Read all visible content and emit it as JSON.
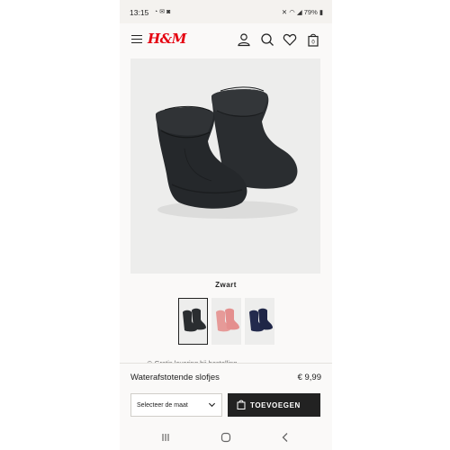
{
  "status_bar": {
    "time": "13:15",
    "notification_icons": [
      "whatsapp-icon",
      "mail-icon",
      "instagram-icon"
    ],
    "system_icons": [
      "mute-icon",
      "wifi-icon",
      "signal-icon",
      "battery-icon"
    ],
    "battery": "79%"
  },
  "header": {
    "logo": "H&M",
    "icons": [
      "menu-icon",
      "account-icon",
      "search-icon",
      "favorites-icon",
      "bag-icon"
    ],
    "bag_count": "0"
  },
  "product": {
    "image": "black-baby-booties-icon",
    "color_name": "Zwart",
    "swatches": [
      {
        "name": "Zwart",
        "color": "#2a2d30",
        "selected": true
      },
      {
        "name": "Roze",
        "color": "#e69a98",
        "selected": false
      },
      {
        "name": "Donkerblauw",
        "color": "#232a4d",
        "selected": false
      }
    ],
    "name": "Waterafstotende slofjes",
    "price": "€ 9,99"
  },
  "delivery_text": "Gratis levering bij bestelling...",
  "actions": {
    "size_placeholder": "Selecteer de maat",
    "add_label": "TOEVOEGEN"
  },
  "colors": {
    "brand": "#e50010",
    "button_bg": "#222222",
    "page_bg": "#faf9f8"
  }
}
